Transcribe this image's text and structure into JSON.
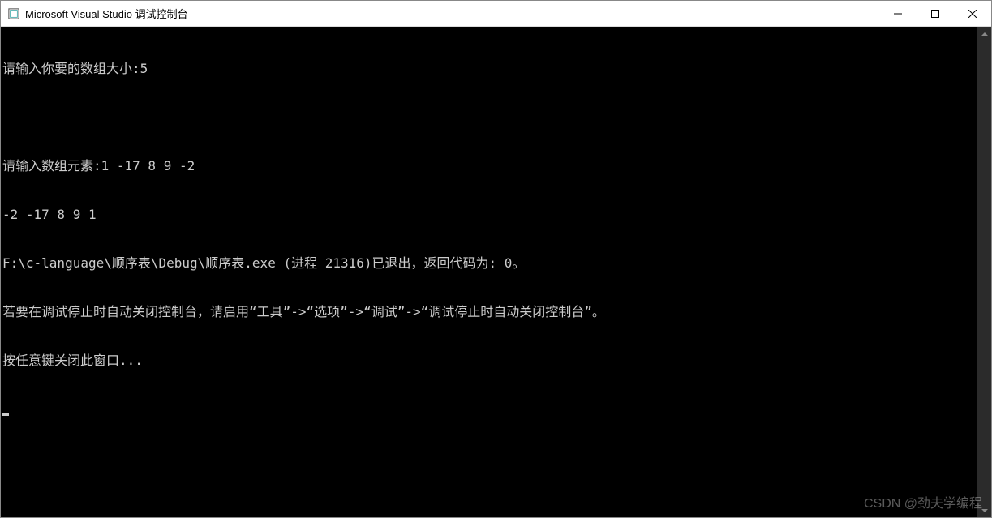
{
  "titlebar": {
    "title": "Microsoft Visual Studio 调试控制台"
  },
  "console": {
    "lines": [
      "请输入你要的数组大小:5",
      "",
      "请输入数组元素:1 -17 8 9 -2",
      "-2 -17 8 9 1",
      "F:\\c-language\\顺序表\\Debug\\顺序表.exe (进程 21316)已退出，返回代码为: 0。",
      "若要在调试停止时自动关闭控制台，请启用“工具”->“选项”->“调试”->“调试停止时自动关闭控制台”。",
      "按任意键关闭此窗口..."
    ]
  },
  "watermark": "CSDN @劲夫学编程"
}
